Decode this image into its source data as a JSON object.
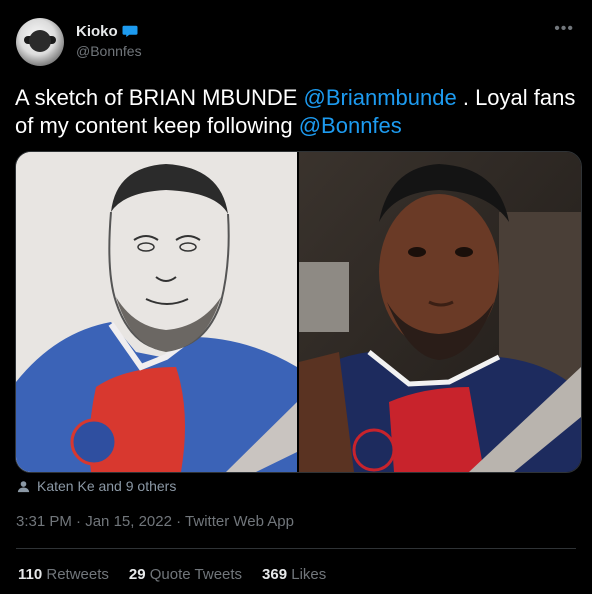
{
  "author": {
    "display_name": "Kioko",
    "handle": "@Bonnfes",
    "avatar_icon": "profile-avatar",
    "badge_icon": "speech-bubble-icon"
  },
  "more_icon": "•••",
  "tweet": {
    "text_1": "A sketch of BRIAN MBUNDE ",
    "mention_1": "@Brianmbunde",
    "text_2": " . Loyal fans of my content keep following ",
    "mention_2": "@Bonnfes"
  },
  "media": {
    "left": "pencil sketch",
    "right": "selfie photo"
  },
  "likers": {
    "text": "Katen Ke and 9 others"
  },
  "timestamp": {
    "time": "3:31 PM",
    "sep1": " · ",
    "date": "Jan 15, 2022",
    "sep2": " · ",
    "source": "Twitter Web App"
  },
  "stats": {
    "retweets_count": "110",
    "retweets_label": "Retweets",
    "quotes_count": "29",
    "quotes_label": "Quote Tweets",
    "likes_count": "369",
    "likes_label": "Likes"
  },
  "colors": {
    "accent": "#1d9bf0",
    "background": "#000000",
    "muted": "#71767b"
  }
}
